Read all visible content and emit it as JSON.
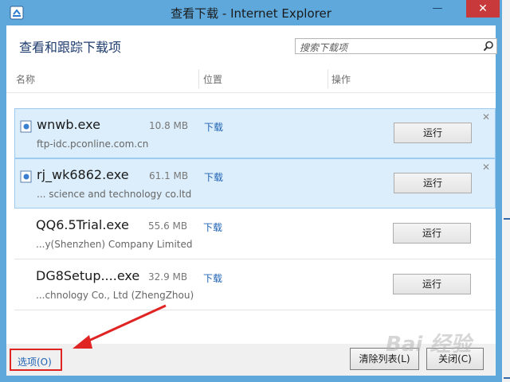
{
  "window": {
    "title": "查看下载 - Internet Explorer"
  },
  "header": {
    "heading": "查看和跟踪下载项"
  },
  "search": {
    "placeholder": "搜索下载项"
  },
  "columns": [
    "名称",
    "位置",
    "操作"
  ],
  "downloads": [
    {
      "name": "wnwb.exe",
      "size": "10.8 MB",
      "source": "ftp-idc.pconline.com.cn",
      "location": "下载",
      "action": "运行",
      "selected": true
    },
    {
      "name": "rj_wk6862.exe",
      "size": "61.1 MB",
      "source": "... science and technology co.ltd",
      "location": "下载",
      "action": "运行",
      "selected": true
    },
    {
      "name": "QQ6.5Trial.exe",
      "size": "55.6 MB",
      "source": "...y(Shenzhen) Company Limited",
      "location": "下载",
      "action": "运行",
      "selected": false
    },
    {
      "name": "DG8Setup....exe",
      "size": "32.9 MB",
      "source": "...chnology Co., Ltd (ZhengZhou)",
      "location": "下载",
      "action": "运行",
      "selected": false
    }
  ],
  "footer": {
    "options": "选项(O)",
    "clear_list": "清除列表(L)",
    "close": "关闭(C)"
  },
  "watermark": "Bai 经验",
  "colors": {
    "accent": "#5fa8db",
    "selected_row": "#dceefb",
    "link": "#2063b4",
    "annotation": "#e02424"
  },
  "icons": [
    "ie-app-icon",
    "minimize-icon",
    "close-icon",
    "search-icon",
    "exe-file-icon",
    "remove-icon",
    "annotation-arrow"
  ]
}
